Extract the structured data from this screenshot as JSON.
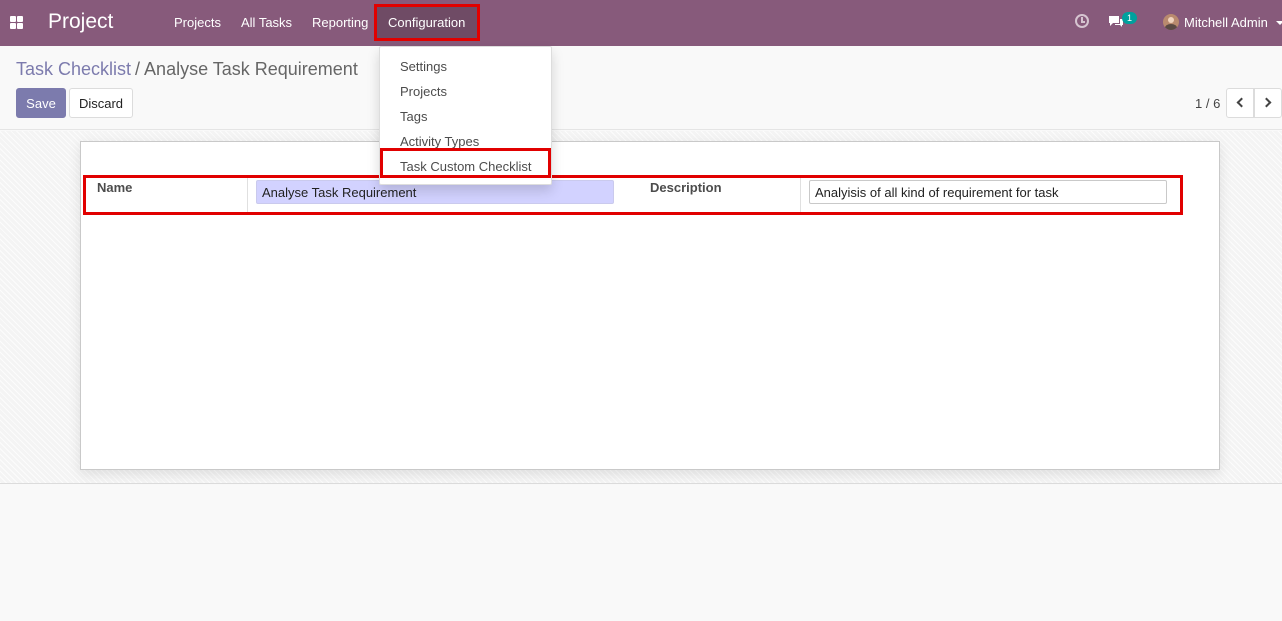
{
  "navbar": {
    "app_title": "Project",
    "menu": [
      "Projects",
      "All Tasks",
      "Reporting",
      "Configuration"
    ],
    "messages_count": "1",
    "user_name": "Mitchell Admin",
    "bg_color": "#875a7b"
  },
  "configuration_menu": {
    "items": [
      "Settings",
      "Projects",
      "Tags",
      "Activity Types",
      "Task Custom Checklist"
    ]
  },
  "breadcrumb": {
    "parent": "Task Checklist",
    "separator": "/",
    "current": "Analyse Task Requirement"
  },
  "buttons": {
    "save": "Save",
    "discard": "Discard"
  },
  "pager": {
    "value": "1 / 6"
  },
  "form": {
    "name_label": "Name",
    "name_value": "Analyse Task Requirement",
    "description_label": "Description",
    "description_value": "Analyisis of all kind of requirement for task"
  },
  "icons": {
    "apps": "apps-grid-icon",
    "activity": "clock-icon",
    "messages": "chat-icon",
    "pager_prev": "chevron-left-icon",
    "pager_next": "chevron-right-icon"
  },
  "colors": {
    "highlight": "#e10000",
    "primary": "#7c7bad"
  }
}
